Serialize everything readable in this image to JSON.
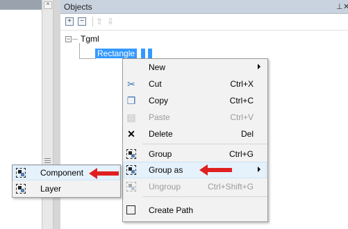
{
  "panel": {
    "title": "Objects",
    "pin_glyph": "⊥",
    "close_glyph": "✕",
    "scroll_up_glyph": "^"
  },
  "toolbar": {
    "expand_glyph": "+",
    "collapse_glyph": "−",
    "up_glyph": "⇧",
    "down_glyph": "⇩"
  },
  "tree": {
    "root_label": "Tgml",
    "expander_glyph": "−",
    "selected_item": "Rectangle"
  },
  "context_menu": {
    "items": [
      {
        "label": "New",
        "shortcut": "",
        "icon": "none",
        "submenu": true,
        "disabled": false
      },
      {
        "label": "Cut",
        "shortcut": "Ctrl+X",
        "icon": "scissors-icon",
        "disabled": false
      },
      {
        "label": "Copy",
        "shortcut": "Ctrl+C",
        "icon": "copy-icon",
        "disabled": false
      },
      {
        "label": "Paste",
        "shortcut": "Ctrl+V",
        "icon": "paste-icon",
        "disabled": true
      },
      {
        "label": "Delete",
        "shortcut": "Del",
        "icon": "delete-x-icon",
        "disabled": false
      },
      {
        "label": "Group",
        "shortcut": "Ctrl+G",
        "icon": "group-icon",
        "disabled": false
      },
      {
        "label": "Group as",
        "shortcut": "",
        "icon": "group-as-icon",
        "submenu": true,
        "disabled": false,
        "highlighted": true
      },
      {
        "label": "Ungroup",
        "shortcut": "Ctrl+Shift+G",
        "icon": "ungroup-icon",
        "disabled": true
      },
      {
        "label": "Create Path",
        "shortcut": "",
        "icon": "create-path-icon",
        "disabled": false
      }
    ],
    "glyphs": {
      "cut": "✂",
      "copy": "❐",
      "paste": "▤",
      "delete": "✕"
    }
  },
  "submenu": {
    "items": [
      {
        "label": "Component",
        "icon": "component-icon",
        "highlighted": true
      },
      {
        "label": "Layer",
        "icon": "layer-icon",
        "highlighted": false
      }
    ]
  },
  "colors": {
    "selection": "#3399ff",
    "menu_bg": "#f2f2f2",
    "highlight": "#e5f1fb",
    "annotation_arrow": "#e02020",
    "panel_header": "#c9d3df"
  }
}
